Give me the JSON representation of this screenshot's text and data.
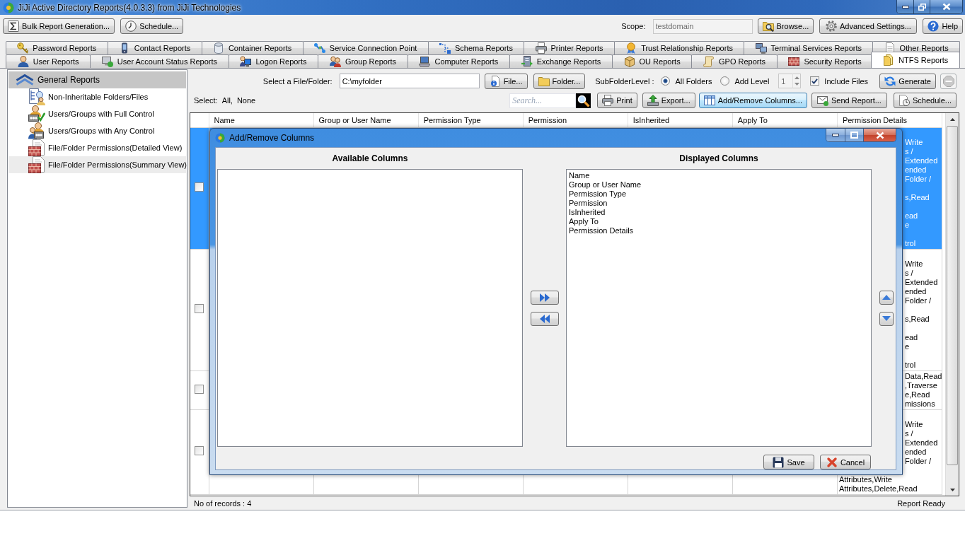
{
  "window": {
    "title": "JiJi Active Directory Reports(4.0.3.3) from JiJi Technologies"
  },
  "toolbar": {
    "left_buttons": [
      {
        "kind": "bulk",
        "label": "Bulk Report Generation..."
      },
      {
        "kind": "schedule",
        "label": "Schedule..."
      }
    ],
    "scope": {
      "label": "Scope:",
      "value": "testdomain",
      "disabled": true
    },
    "right_buttons": [
      {
        "kind": "browse",
        "label": "Browse..."
      },
      {
        "kind": "settings",
        "label": "Advanced Settings..."
      },
      {
        "kind": "help",
        "label": "Help"
      }
    ]
  },
  "tab_rows": [
    [
      {
        "kind": "password",
        "label": "Password Reports",
        "selected": false
      },
      {
        "kind": "contact",
        "label": "Contact Reports",
        "selected": false
      },
      {
        "kind": "container",
        "label": "Container Reports",
        "selected": false
      },
      {
        "kind": "connection",
        "label": "Service Connection Point",
        "selected": false
      },
      {
        "kind": "schema",
        "label": "Schema Reports",
        "selected": false
      },
      {
        "kind": "printer",
        "label": "Printer Reports",
        "selected": false
      },
      {
        "kind": "trust",
        "label": "Trust Relationship Reports",
        "selected": false
      },
      {
        "kind": "terminal",
        "label": "Terminal Services Reports",
        "selected": false
      },
      {
        "kind": "other",
        "label": "Other Reports",
        "selected": false
      }
    ],
    [
      {
        "kind": "user",
        "label": "User Reports",
        "selected": false
      },
      {
        "kind": "status",
        "label": "User Account Status Reports",
        "selected": false
      },
      {
        "kind": "logon",
        "label": "Logon Reports",
        "selected": false
      },
      {
        "kind": "group",
        "label": "Group Reports",
        "selected": false
      },
      {
        "kind": "computer",
        "label": "Computer Reports",
        "selected": false
      },
      {
        "kind": "exchange",
        "label": "Exchange Reports",
        "selected": false
      },
      {
        "kind": "ou",
        "label": "OU Reports",
        "selected": false
      },
      {
        "kind": "gpo",
        "label": "GPO Reports",
        "selected": false
      },
      {
        "kind": "security",
        "label": "Security Reports",
        "selected": false
      },
      {
        "kind": "ntfs",
        "label": "NTFS Reports",
        "selected": true
      }
    ]
  ],
  "sidebar": {
    "group": {
      "title": "General Reports",
      "expanded": true
    },
    "items": [
      {
        "kind": "tree",
        "label": "Non-Inheritable Folders/Files",
        "selected": false
      },
      {
        "kind": "check",
        "label": "Users/Groups with Full Control",
        "selected": false
      },
      {
        "kind": "users",
        "label": "Users/Groups with Any Control",
        "selected": false
      },
      {
        "kind": "wall",
        "label": "File/Folder Permissions(Detailed View)",
        "selected": false
      },
      {
        "kind": "wall",
        "label": "File/Folder Permissions(Summary View)",
        "selected": true
      }
    ]
  },
  "controls": {
    "path": {
      "label": "Select a File/Folder:",
      "value": "C:\\myfolder"
    },
    "path_buttons": [
      {
        "kind": "file",
        "label": "File..."
      },
      {
        "kind": "folder",
        "label": "Folder..."
      }
    ],
    "subfolder": {
      "label": "SubFolderLevel :",
      "options": [
        {
          "label": "All Folders",
          "selected": true
        },
        {
          "label": "Add Level",
          "selected": false
        }
      ],
      "level": {
        "value": "1",
        "disabled": true
      }
    },
    "include_files": {
      "label": "Include Files",
      "checked": true
    },
    "generate": {
      "label": "Generate"
    },
    "stop": {
      "disabled": true
    },
    "select": {
      "label": "Select:",
      "links": [
        "All,",
        "None"
      ]
    },
    "search": {
      "placeholder": "Search..."
    },
    "actions": [
      {
        "kind": "print",
        "label": "Print",
        "focused": false
      },
      {
        "kind": "export",
        "label": "Export...",
        "focused": false
      },
      {
        "kind": "columns",
        "label": "Add/Remove Columns...",
        "focused": true
      },
      {
        "kind": "send",
        "label": "Send Report...",
        "focused": false
      },
      {
        "kind": "schedule",
        "label": "Schedule...",
        "focused": false
      }
    ]
  },
  "table": {
    "columns": [
      "Name",
      "Group or User Name",
      "Permission Type",
      "Permission",
      "IsInherited",
      "Apply To",
      "Permission Details"
    ],
    "rows": [
      {
        "selected": true,
        "checked": false,
        "permission_details": "\nWrite\ns /\nExtended\nended\nFolder /\n\ns,Read\n\nead\ne\n\ntrol"
      },
      {
        "selected": false,
        "checked": false,
        "permission_details": "\nWrite\ns /\nExtended\nended\nFolder /\n\ns,Read\n\nead\ne\n\ntrol"
      },
      {
        "selected": false,
        "checked": false,
        "permission_details": "Data,Read\n,Traverse\ne,Read\nmissions"
      },
      {
        "selected": false,
        "checked": false,
        "permission_details": "\nWrite\ns /\nExtended\nended\nFolder /",
        "permission_details_continued": "Attributes,Write\nAttributes,Delete,Read"
      }
    ]
  },
  "dialog": {
    "title": "Add/Remove Columns",
    "available": {
      "heading": "Available Columns"
    },
    "displayed": {
      "heading": "Displayed Columns",
      "items": [
        {
          "label": "Name",
          "selected": false
        },
        {
          "label": "Group or User Name",
          "selected": false
        },
        {
          "label": "Permission Type",
          "selected": false
        },
        {
          "label": "Permission",
          "selected": false
        },
        {
          "label": "IsInherited",
          "selected": false
        },
        {
          "label": "Apply To",
          "selected": false
        },
        {
          "label": "Permission Details",
          "selected": false
        }
      ]
    },
    "buttons": [
      {
        "kind": "save",
        "label": "Save"
      },
      {
        "kind": "cancel",
        "label": "Cancel"
      }
    ]
  },
  "status_bar": {
    "records": "No of records : 4",
    "status": "Report Ready"
  }
}
